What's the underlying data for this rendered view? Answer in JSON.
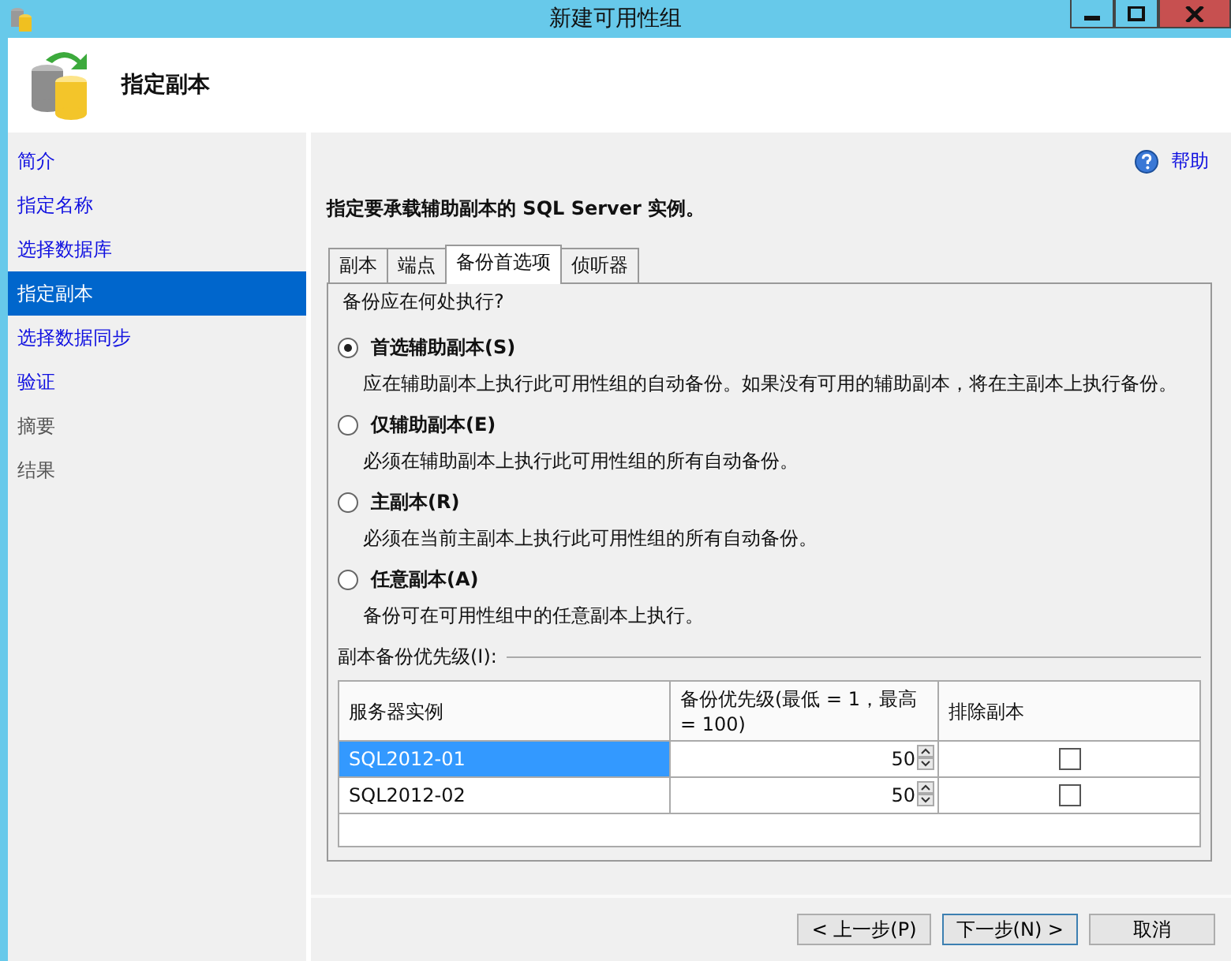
{
  "window": {
    "title": "新建可用性组"
  },
  "header": {
    "title": "指定副本"
  },
  "sidebar": {
    "items": [
      {
        "label": "简介",
        "selected": false,
        "disabled": false
      },
      {
        "label": "指定名称",
        "selected": false,
        "disabled": false
      },
      {
        "label": "选择数据库",
        "selected": false,
        "disabled": false
      },
      {
        "label": "指定副本",
        "selected": true,
        "disabled": false
      },
      {
        "label": "选择数据同步",
        "selected": false,
        "disabled": false
      },
      {
        "label": "验证",
        "selected": false,
        "disabled": false
      },
      {
        "label": "摘要",
        "selected": false,
        "disabled": true
      },
      {
        "label": "结果",
        "selected": false,
        "disabled": true
      }
    ]
  },
  "help": {
    "label": "帮助"
  },
  "instruction": "指定要承载辅助副本的 SQL Server 实例。",
  "tabs": [
    {
      "label": "副本",
      "selected": false
    },
    {
      "label": "端点",
      "selected": false
    },
    {
      "label": "备份首选项",
      "selected": true
    },
    {
      "label": "侦听器",
      "selected": false
    }
  ],
  "question": "备份应在何处执行?",
  "options": [
    {
      "label": "首选辅助副本(S)",
      "description": "应在辅助副本上执行此可用性组的自动备份。如果没有可用的辅助副本，将在主副本上执行备份。",
      "selected": true
    },
    {
      "label": "仅辅助副本(E)",
      "description": "必须在辅助副本上执行此可用性组的所有自动备份。",
      "selected": false
    },
    {
      "label": "主副本(R)",
      "description": "必须在当前主副本上执行此可用性组的所有自动备份。",
      "selected": false
    },
    {
      "label": "任意副本(A)",
      "description": "备份可在可用性组中的任意副本上执行。",
      "selected": false
    }
  ],
  "priority_group": {
    "label": "副本备份优先级(I):"
  },
  "table": {
    "columns": [
      "服务器实例",
      "备份优先级(最低 = 1，最高 = 100)",
      "排除副本"
    ],
    "rows": [
      {
        "server": "SQL2012-01",
        "priority": "50",
        "excluded": false,
        "selected": true
      },
      {
        "server": "SQL2012-02",
        "priority": "50",
        "excluded": false,
        "selected": false
      }
    ]
  },
  "buttons": [
    {
      "label": "< 上一步(P)",
      "kind": "normal"
    },
    {
      "label": "下一步(N) >",
      "kind": "default"
    },
    {
      "label": "取消",
      "kind": "normal"
    }
  ]
}
